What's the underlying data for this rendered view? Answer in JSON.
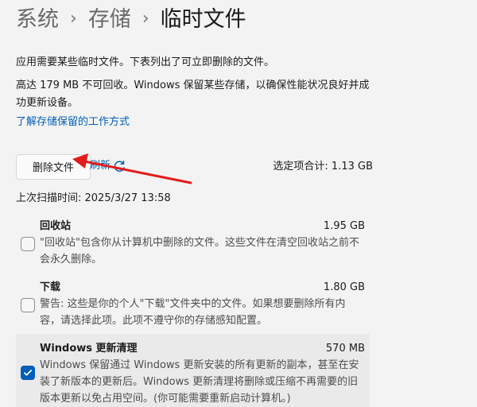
{
  "breadcrumb": {
    "items": [
      "系统",
      "存储",
      "临时文件"
    ],
    "separator": "›"
  },
  "intro": {
    "text": "应用需要某些临时文件。下表列出了可立即删除的文件。"
  },
  "note": {
    "text": "高达 179 MB 不可回收。Windows 保留某些存储，以确保性能状况良好并成功更新设备。"
  },
  "learn_more": {
    "text": "了解存储保留的工作方式"
  },
  "actions": {
    "delete_label": "删除文件",
    "refresh_label": "刷新",
    "refresh_icon": "refresh-icon"
  },
  "summary": {
    "selected_total": "选定项合计: 1.13 GB",
    "last_scan": "上次扫描时间: 2025/3/27 13:58"
  },
  "items": [
    {
      "title": "回收站",
      "size": "1.95 GB",
      "description": "\"回收站\"包含你从计算机中删除的文件。这些文件在清空回收站之前不会永久删除。",
      "checked": false
    },
    {
      "title": "下载",
      "size": "1.80 GB",
      "description": "警告: 这些是你的个人\"下载\"文件夹中的文件。如果想要删除所有内容，请选择此项。此项不遵守你的存储感知配置。",
      "checked": false
    },
    {
      "title": "Windows 更新清理",
      "size": "570 MB",
      "description": "Windows 保留通过 Windows 更新安装的所有更新的副本，甚至在安装了新版本的更新后。Windows 更新清理将删除或压缩不再需要的旧版本更新以免占用空间。(你可能需要重新启动计算机。)",
      "checked": true
    }
  ],
  "colors": {
    "accent": "#005fb8",
    "annotation": "#e21b1b",
    "background": "#f3f3f3"
  }
}
